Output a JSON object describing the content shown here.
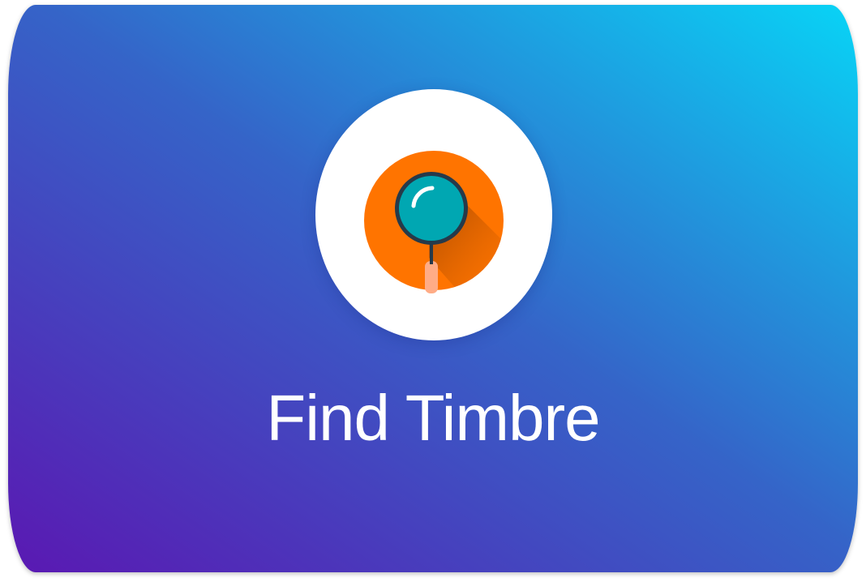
{
  "card": {
    "title": "Find Timbre",
    "gradient_start": "#5a18b2",
    "gradient_mid": "#3564c8",
    "gradient_end": "#08d4f6"
  },
  "logo": {
    "icon": "magnifying-glass-icon",
    "disc_color": "#ffffff",
    "badge_color": "#ff7400",
    "lens_color": "#00a7b2",
    "frame_color": "#263a4a",
    "handle_color": "#ffac86"
  }
}
